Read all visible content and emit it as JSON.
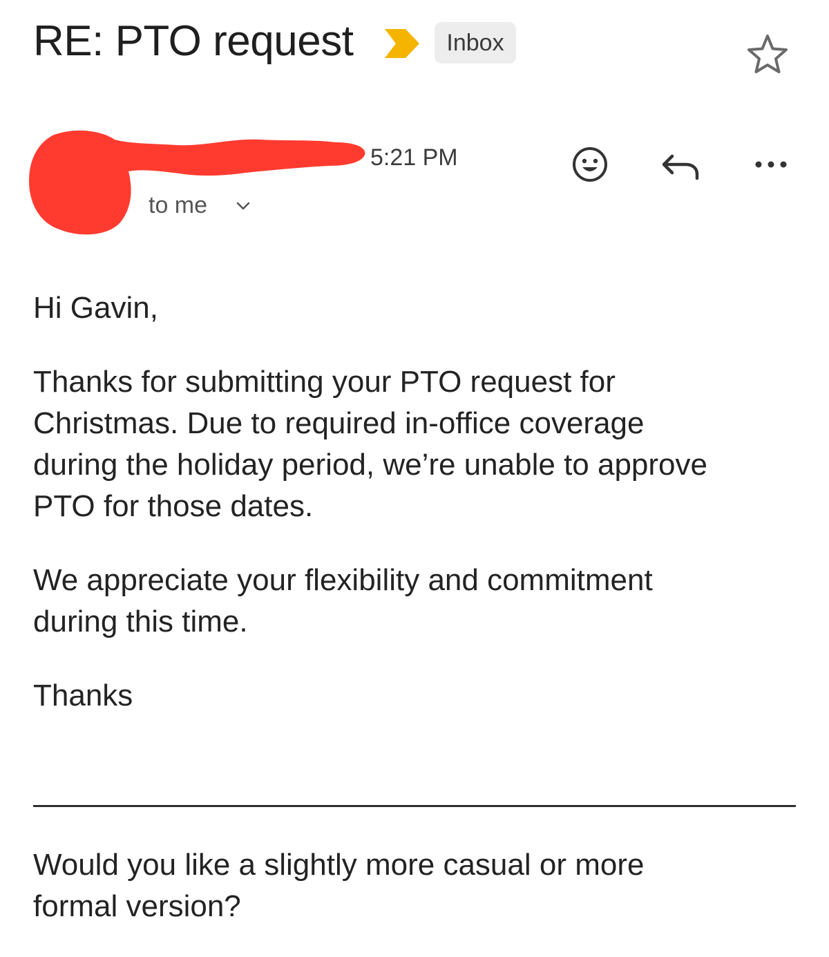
{
  "header": {
    "subject": "RE: PTO request",
    "label": "Inbox",
    "importance_icon": "importance-marker-icon",
    "star_icon": "star-icon",
    "colors": {
      "importance": "#F4B400",
      "label_chip_bg": "#EDEDED"
    }
  },
  "message_meta": {
    "time": "5:21 PM",
    "recipient": "to me",
    "sender_redaction_color": "#FF3B30",
    "actions": [
      "emoji-reaction-icon",
      "reply-icon",
      "more-options-icon"
    ]
  },
  "body": {
    "greeting": "Hi Gavin,",
    "paragraph_1": [
      "Thanks for submitting your PTO request for",
      "Christmas. Due to required in-office coverage",
      "during the holiday period, we’re unable to approve",
      "PTO for those dates."
    ],
    "paragraph_2": [
      "We appreciate your flexibility and commitment",
      "during this time."
    ],
    "signoff": "Thanks",
    "followup": [
      "Would you like a slightly more casual or more",
      "formal version?"
    ]
  }
}
